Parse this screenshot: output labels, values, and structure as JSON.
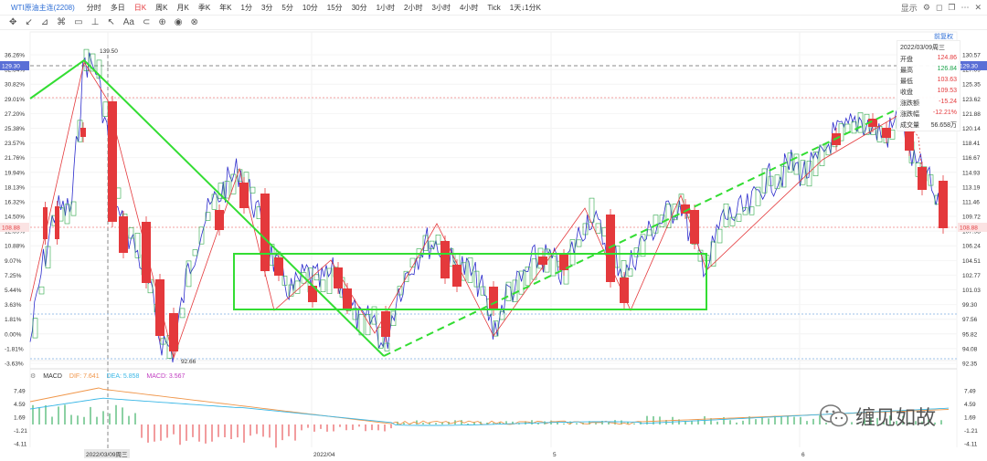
{
  "toolbar": {
    "ticker": "WTI原油主连(2208)",
    "periods": [
      "分时",
      "多日",
      "日K",
      "周K",
      "月K",
      "季K",
      "年K",
      "1分",
      "3分",
      "5分",
      "10分",
      "15分",
      "30分",
      "1小时",
      "2小时",
      "3小时",
      "4小时",
      "Tick",
      "1天↓1分K"
    ],
    "active_period": "日K",
    "display_label": "显示",
    "forward_adjust": "前复权"
  },
  "price_axis": {
    "left_pct": [
      "36.26%",
      "32.64%",
      "30.82%",
      "29.01%",
      "27.20%",
      "25.38%",
      "23.57%",
      "21.76%",
      "19.94%",
      "18.13%",
      "16.32%",
      "14.50%",
      "12.69%",
      "10.88%",
      "9.07%",
      "7.25%",
      "5.44%",
      "3.63%",
      "1.81%",
      "0.00%",
      "-1.81%",
      "-3.63%"
    ],
    "right_price": [
      "130.57",
      "127.09",
      "125.35",
      "123.62",
      "121.88",
      "120.14",
      "118.41",
      "116.67",
      "114.93",
      "113.19",
      "111.46",
      "109.72",
      "107.98",
      "106.24",
      "104.51",
      "102.77",
      "101.03",
      "99.30",
      "97.56",
      "95.82",
      "94.08",
      "92.35"
    ],
    "crosshair_left": "129.30",
    "crosshair_right": "129.30",
    "last_left": "108.88",
    "last_right": "108.88",
    "high_mark": "139.50",
    "low_mark": "92.66"
  },
  "ohlc_panel": {
    "date": "2022/03/09周三",
    "rows": [
      {
        "label": "开盘",
        "value": "124.86"
      },
      {
        "label": "最高",
        "value": "126.84"
      },
      {
        "label": "最低",
        "value": "103.63"
      },
      {
        "label": "收盘",
        "value": "109.53"
      },
      {
        "label": "涨跌额",
        "value": "-15.24"
      },
      {
        "label": "涨跌幅",
        "value": "-12.21%"
      },
      {
        "label": "成交量",
        "value": "56.658万"
      }
    ]
  },
  "macd": {
    "label": "MACD",
    "dif": "DIF: 7.641",
    "dea": "DEA: 5.858",
    "macd": "MACD: 3.567",
    "axis_left": [
      "7.49",
      "4.59",
      "1.69",
      "-1.21",
      "-4.11"
    ],
    "axis_right": [
      "7.49",
      "4.59",
      "1.69",
      "-1.21",
      "-4.11"
    ]
  },
  "time_axis": [
    "2022/03/09周三",
    "2022/04",
    "5",
    "6"
  ],
  "watermark": "缠见如故",
  "colors": {
    "up": "#e4393c",
    "down": "#1aa34a",
    "kline_box": "#2ea84a",
    "green_line": "#33dd33",
    "blue_line": "#2c2ccc",
    "dif": "#f0964a",
    "dea": "#3ab7e6"
  }
}
